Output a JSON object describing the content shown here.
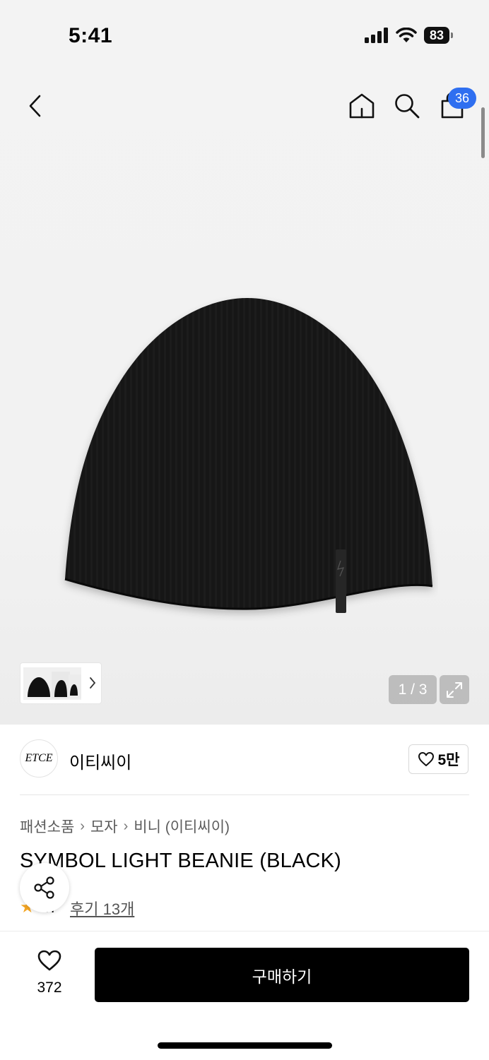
{
  "status_bar": {
    "time": "5:41",
    "battery": "83"
  },
  "header": {
    "cart_count": "36"
  },
  "gallery": {
    "page_indicator": "1 / 3",
    "current_page": 1,
    "total_pages": 3,
    "icons": [
      "back-icon",
      "home-icon",
      "search-icon",
      "cart-icon",
      "expand-icon",
      "chevron-right-icon"
    ]
  },
  "brand": {
    "logo_text": "ETCE",
    "name": "이티씨이",
    "likes": "5만"
  },
  "breadcrumb": [
    "패션소품",
    "모자",
    "비니 (이티씨이)"
  ],
  "product": {
    "title": "SYMBOL LIGHT BEANIE (BLACK)",
    "rating_partial": ".7",
    "reviews_label": "후기 13개"
  },
  "bottom_bar": {
    "wish_count": "372",
    "buy_label": "구매하기"
  },
  "colors": {
    "accent_badge": "#2f6ff0",
    "buy_button": "#000000",
    "star": "#f5a623"
  }
}
